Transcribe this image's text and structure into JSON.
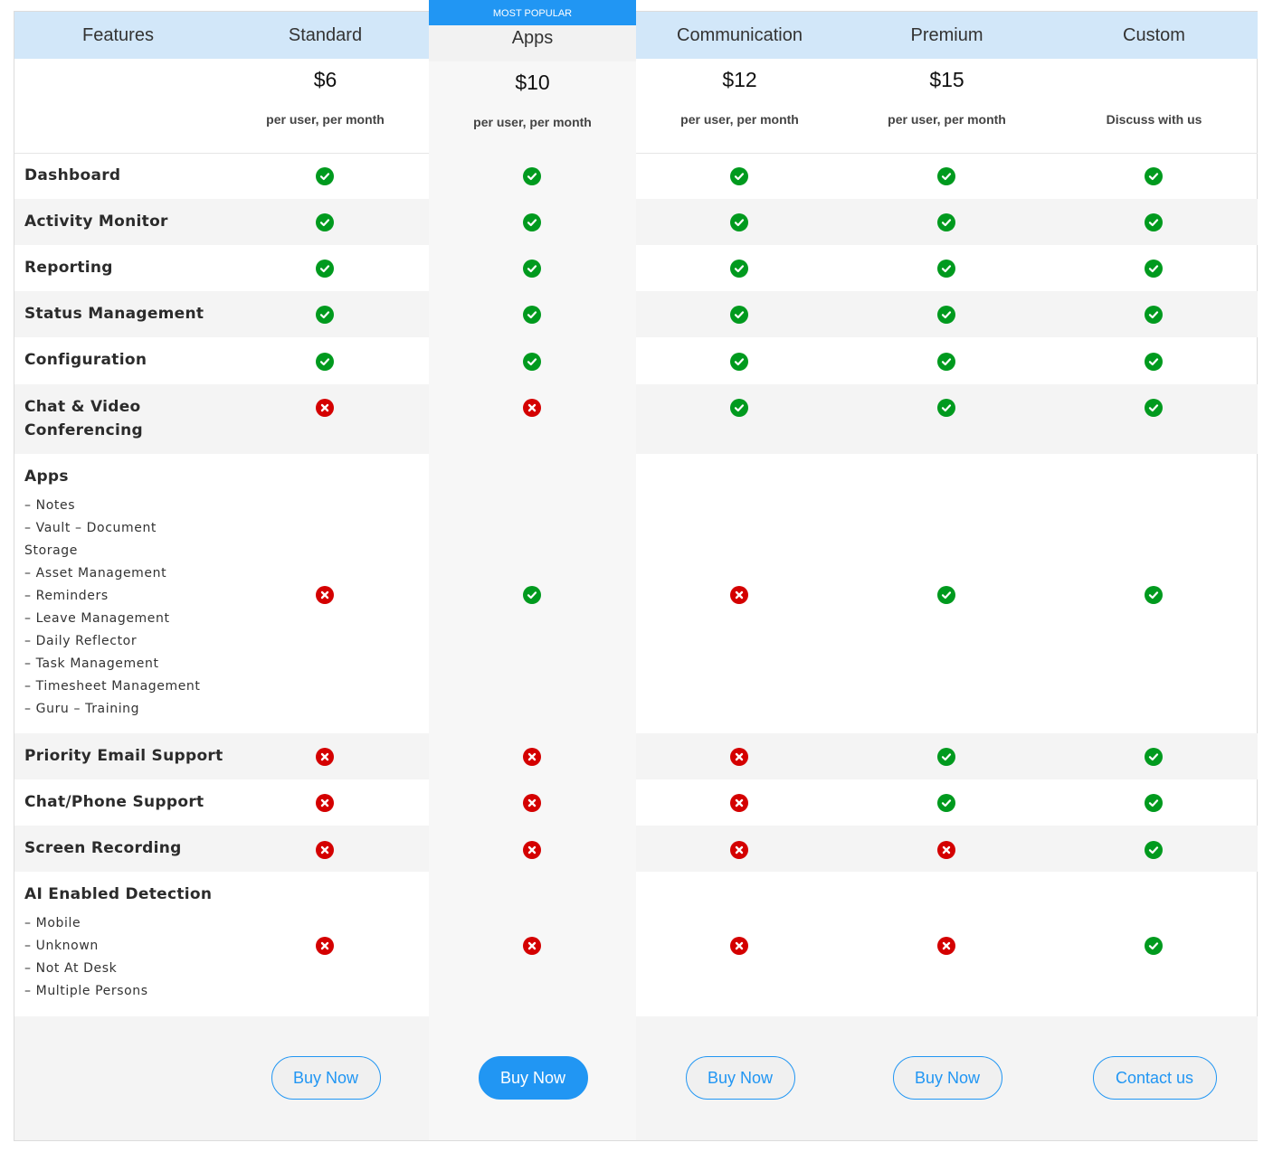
{
  "header": {
    "features_label": "Features",
    "popular_badge": "MOST POPULAR"
  },
  "plans": [
    {
      "name": "Standard",
      "price": "$6",
      "note": "per user, per month",
      "cta": "Buy Now",
      "cta_style": "outline"
    },
    {
      "name": "Apps",
      "price": "$10",
      "note": "per user, per month",
      "cta": "Buy Now",
      "cta_style": "solid",
      "popular": true
    },
    {
      "name": "Communication",
      "price": "$12",
      "note": "per user, per month",
      "cta": "Buy Now",
      "cta_style": "outline"
    },
    {
      "name": "Premium",
      "price": "$15",
      "note": "per user, per month",
      "cta": "Buy Now",
      "cta_style": "outline"
    },
    {
      "name": "Custom",
      "price": "",
      "note": "Discuss with us",
      "cta": "Contact us",
      "cta_style": "outline"
    }
  ],
  "features": [
    {
      "label": "Dashboard",
      "sub": [],
      "values": [
        true,
        true,
        true,
        true,
        true
      ]
    },
    {
      "label": "Activity Monitor",
      "sub": [],
      "values": [
        true,
        true,
        true,
        true,
        true
      ]
    },
    {
      "label": "Reporting",
      "sub": [],
      "values": [
        true,
        true,
        true,
        true,
        true
      ]
    },
    {
      "label": "Status Management",
      "sub": [],
      "values": [
        true,
        true,
        true,
        true,
        true
      ]
    },
    {
      "label": "Configuration",
      "sub": [],
      "values": [
        true,
        true,
        true,
        true,
        true
      ]
    },
    {
      "label": "Chat & Video Conferencing",
      "sub": [],
      "values": [
        false,
        false,
        true,
        true,
        true
      ]
    },
    {
      "label": "Apps",
      "sub": [
        "–  Notes",
        "–  Vault – Document",
        "Storage",
        "–  Asset Management",
        "–  Reminders",
        "–  Leave Management",
        "–  Daily Reflector",
        "–  Task Management",
        "–  Timesheet Management",
        "–  Guru – Training"
      ],
      "values": [
        false,
        true,
        false,
        true,
        true
      ]
    },
    {
      "label": "Priority Email Support",
      "sub": [],
      "values": [
        false,
        false,
        false,
        true,
        true
      ]
    },
    {
      "label": "Chat/Phone Support",
      "sub": [],
      "values": [
        false,
        false,
        false,
        true,
        true
      ]
    },
    {
      "label": "Screen Recording",
      "sub": [],
      "values": [
        false,
        false,
        false,
        false,
        true
      ]
    },
    {
      "label": "AI Enabled Detection",
      "sub": [
        "–  Mobile",
        "–  Unknown",
        "–  Not At Desk",
        "–  Multiple Persons"
      ],
      "values": [
        false,
        false,
        false,
        false,
        true
      ]
    }
  ],
  "icons": {
    "yes": "check-circle-icon",
    "no": "x-circle-icon"
  },
  "colors": {
    "accent": "#2196f3",
    "header_bg": "#d2e7f9",
    "yes": "#009a1e",
    "no": "#d40000"
  }
}
